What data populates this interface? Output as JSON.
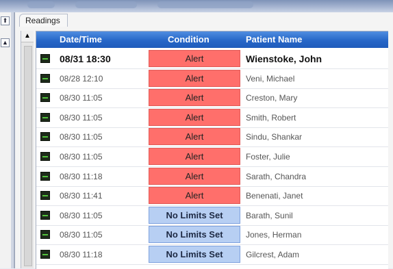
{
  "panel": {
    "tab_label": "Readings"
  },
  "toolbar": {
    "pin_icon_label": "⬆",
    "up_icon_label": "▲"
  },
  "table": {
    "headers": [
      "Date/Time",
      "Condition",
      "Patient Name"
    ],
    "rows": [
      {
        "datetime": "08/31 18:30",
        "condition": "Alert",
        "patient": "Wienstoke, John",
        "highlight": true
      },
      {
        "datetime": "08/28 12:10",
        "condition": "Alert",
        "patient": "Veni, Michael"
      },
      {
        "datetime": "08/30 11:05",
        "condition": "Alert",
        "patient": "Creston, Mary"
      },
      {
        "datetime": "08/30 11:05",
        "condition": "Alert",
        "patient": "Smith, Robert"
      },
      {
        "datetime": "08/30 11:05",
        "condition": "Alert",
        "patient": "Sindu, Shankar"
      },
      {
        "datetime": "08/30 11:05",
        "condition": "Alert",
        "patient": "Foster, Julie"
      },
      {
        "datetime": "08/30 11:18",
        "condition": "Alert",
        "patient": "Sarath, Chandra"
      },
      {
        "datetime": "08/30 11:41",
        "condition": "Alert",
        "patient": "Benenati, Janet"
      },
      {
        "datetime": "08/30 11:05",
        "condition": "No Limits Set",
        "patient": "Barath, Sunil"
      },
      {
        "datetime": "08/30 11:05",
        "condition": "No Limits Set",
        "patient": "Jones, Herman"
      },
      {
        "datetime": "08/30 11:18",
        "condition": "No Limits Set",
        "patient": "Gilcrest, Adam"
      }
    ]
  },
  "colors": {
    "alert_bg": "#ff6f6b",
    "nolimits_bg": "#b7cff3",
    "header_bg": "#2767c8"
  },
  "icons": {
    "row_icon": "monitor-icon",
    "pin": "pin-icon",
    "scroll_up": "arrow-up-icon"
  }
}
